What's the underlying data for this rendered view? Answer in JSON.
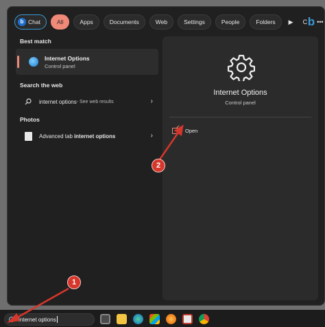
{
  "filters": [
    {
      "label": "Chat",
      "name": "filter-chat"
    },
    {
      "label": "All",
      "name": "filter-all"
    },
    {
      "label": "Apps",
      "name": "filter-apps"
    },
    {
      "label": "Documents",
      "name": "filter-documents"
    },
    {
      "label": "Web",
      "name": "filter-web"
    },
    {
      "label": "Settings",
      "name": "filter-settings"
    },
    {
      "label": "People",
      "name": "filter-people"
    },
    {
      "label": "Folders",
      "name": "filter-folders"
    }
  ],
  "filter_extra": {
    "play": "▶",
    "c": "C",
    "more": "•••"
  },
  "left": {
    "best_match_header": "Best match",
    "best_title": "Internet Options",
    "best_sub": "Control panel",
    "web_header": "Search the web",
    "web_query": "internet options",
    "web_suffix": " - See web results",
    "photos_header": "Photos",
    "photo_prefix": "Advanced tab ",
    "photo_bold": "internet options"
  },
  "right": {
    "title": "Internet Options",
    "subtitle": "Control panel",
    "open_label": "Open"
  },
  "taskbar": {
    "search_text": "internet options",
    "apps": [
      "task-view-icon",
      "file-explorer-icon",
      "edge-icon",
      "store-icon",
      "firefox-icon",
      "app-icon",
      "chrome-icon"
    ]
  },
  "annotations": {
    "badge1": "1",
    "badge2": "2"
  },
  "colors": {
    "accent": "#f08a78",
    "bing": "#3a9bd8",
    "badge": "#d7362b"
  }
}
